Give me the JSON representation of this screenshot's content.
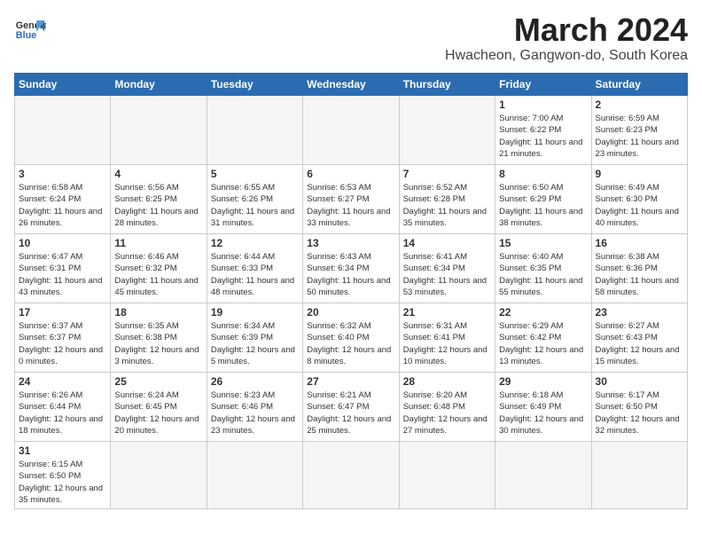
{
  "logo": {
    "line1": "General",
    "line2": "Blue"
  },
  "title": "March 2024",
  "location": "Hwacheon, Gangwon-do, South Korea",
  "days_of_week": [
    "Sunday",
    "Monday",
    "Tuesday",
    "Wednesday",
    "Thursday",
    "Friday",
    "Saturday"
  ],
  "weeks": [
    [
      {
        "day": "",
        "info": ""
      },
      {
        "day": "",
        "info": ""
      },
      {
        "day": "",
        "info": ""
      },
      {
        "day": "",
        "info": ""
      },
      {
        "day": "",
        "info": ""
      },
      {
        "day": "1",
        "info": "Sunrise: 7:00 AM\nSunset: 6:22 PM\nDaylight: 11 hours and 21 minutes."
      },
      {
        "day": "2",
        "info": "Sunrise: 6:59 AM\nSunset: 6:23 PM\nDaylight: 11 hours and 23 minutes."
      }
    ],
    [
      {
        "day": "3",
        "info": "Sunrise: 6:58 AM\nSunset: 6:24 PM\nDaylight: 11 hours and 26 minutes."
      },
      {
        "day": "4",
        "info": "Sunrise: 6:56 AM\nSunset: 6:25 PM\nDaylight: 11 hours and 28 minutes."
      },
      {
        "day": "5",
        "info": "Sunrise: 6:55 AM\nSunset: 6:26 PM\nDaylight: 11 hours and 31 minutes."
      },
      {
        "day": "6",
        "info": "Sunrise: 6:53 AM\nSunset: 6:27 PM\nDaylight: 11 hours and 33 minutes."
      },
      {
        "day": "7",
        "info": "Sunrise: 6:52 AM\nSunset: 6:28 PM\nDaylight: 11 hours and 35 minutes."
      },
      {
        "day": "8",
        "info": "Sunrise: 6:50 AM\nSunset: 6:29 PM\nDaylight: 11 hours and 38 minutes."
      },
      {
        "day": "9",
        "info": "Sunrise: 6:49 AM\nSunset: 6:30 PM\nDaylight: 11 hours and 40 minutes."
      }
    ],
    [
      {
        "day": "10",
        "info": "Sunrise: 6:47 AM\nSunset: 6:31 PM\nDaylight: 11 hours and 43 minutes."
      },
      {
        "day": "11",
        "info": "Sunrise: 6:46 AM\nSunset: 6:32 PM\nDaylight: 11 hours and 45 minutes."
      },
      {
        "day": "12",
        "info": "Sunrise: 6:44 AM\nSunset: 6:33 PM\nDaylight: 11 hours and 48 minutes."
      },
      {
        "day": "13",
        "info": "Sunrise: 6:43 AM\nSunset: 6:34 PM\nDaylight: 11 hours and 50 minutes."
      },
      {
        "day": "14",
        "info": "Sunrise: 6:41 AM\nSunset: 6:34 PM\nDaylight: 11 hours and 53 minutes."
      },
      {
        "day": "15",
        "info": "Sunrise: 6:40 AM\nSunset: 6:35 PM\nDaylight: 11 hours and 55 minutes."
      },
      {
        "day": "16",
        "info": "Sunrise: 6:38 AM\nSunset: 6:36 PM\nDaylight: 11 hours and 58 minutes."
      }
    ],
    [
      {
        "day": "17",
        "info": "Sunrise: 6:37 AM\nSunset: 6:37 PM\nDaylight: 12 hours and 0 minutes."
      },
      {
        "day": "18",
        "info": "Sunrise: 6:35 AM\nSunset: 6:38 PM\nDaylight: 12 hours and 3 minutes."
      },
      {
        "day": "19",
        "info": "Sunrise: 6:34 AM\nSunset: 6:39 PM\nDaylight: 12 hours and 5 minutes."
      },
      {
        "day": "20",
        "info": "Sunrise: 6:32 AM\nSunset: 6:40 PM\nDaylight: 12 hours and 8 minutes."
      },
      {
        "day": "21",
        "info": "Sunrise: 6:31 AM\nSunset: 6:41 PM\nDaylight: 12 hours and 10 minutes."
      },
      {
        "day": "22",
        "info": "Sunrise: 6:29 AM\nSunset: 6:42 PM\nDaylight: 12 hours and 13 minutes."
      },
      {
        "day": "23",
        "info": "Sunrise: 6:27 AM\nSunset: 6:43 PM\nDaylight: 12 hours and 15 minutes."
      }
    ],
    [
      {
        "day": "24",
        "info": "Sunrise: 6:26 AM\nSunset: 6:44 PM\nDaylight: 12 hours and 18 minutes."
      },
      {
        "day": "25",
        "info": "Sunrise: 6:24 AM\nSunset: 6:45 PM\nDaylight: 12 hours and 20 minutes."
      },
      {
        "day": "26",
        "info": "Sunrise: 6:23 AM\nSunset: 6:46 PM\nDaylight: 12 hours and 23 minutes."
      },
      {
        "day": "27",
        "info": "Sunrise: 6:21 AM\nSunset: 6:47 PM\nDaylight: 12 hours and 25 minutes."
      },
      {
        "day": "28",
        "info": "Sunrise: 6:20 AM\nSunset: 6:48 PM\nDaylight: 12 hours and 27 minutes."
      },
      {
        "day": "29",
        "info": "Sunrise: 6:18 AM\nSunset: 6:49 PM\nDaylight: 12 hours and 30 minutes."
      },
      {
        "day": "30",
        "info": "Sunrise: 6:17 AM\nSunset: 6:50 PM\nDaylight: 12 hours and 32 minutes."
      }
    ],
    [
      {
        "day": "31",
        "info": "Sunrise: 6:15 AM\nSunset: 6:50 PM\nDaylight: 12 hours and 35 minutes."
      },
      {
        "day": "",
        "info": ""
      },
      {
        "day": "",
        "info": ""
      },
      {
        "day": "",
        "info": ""
      },
      {
        "day": "",
        "info": ""
      },
      {
        "day": "",
        "info": ""
      },
      {
        "day": "",
        "info": ""
      }
    ]
  ]
}
